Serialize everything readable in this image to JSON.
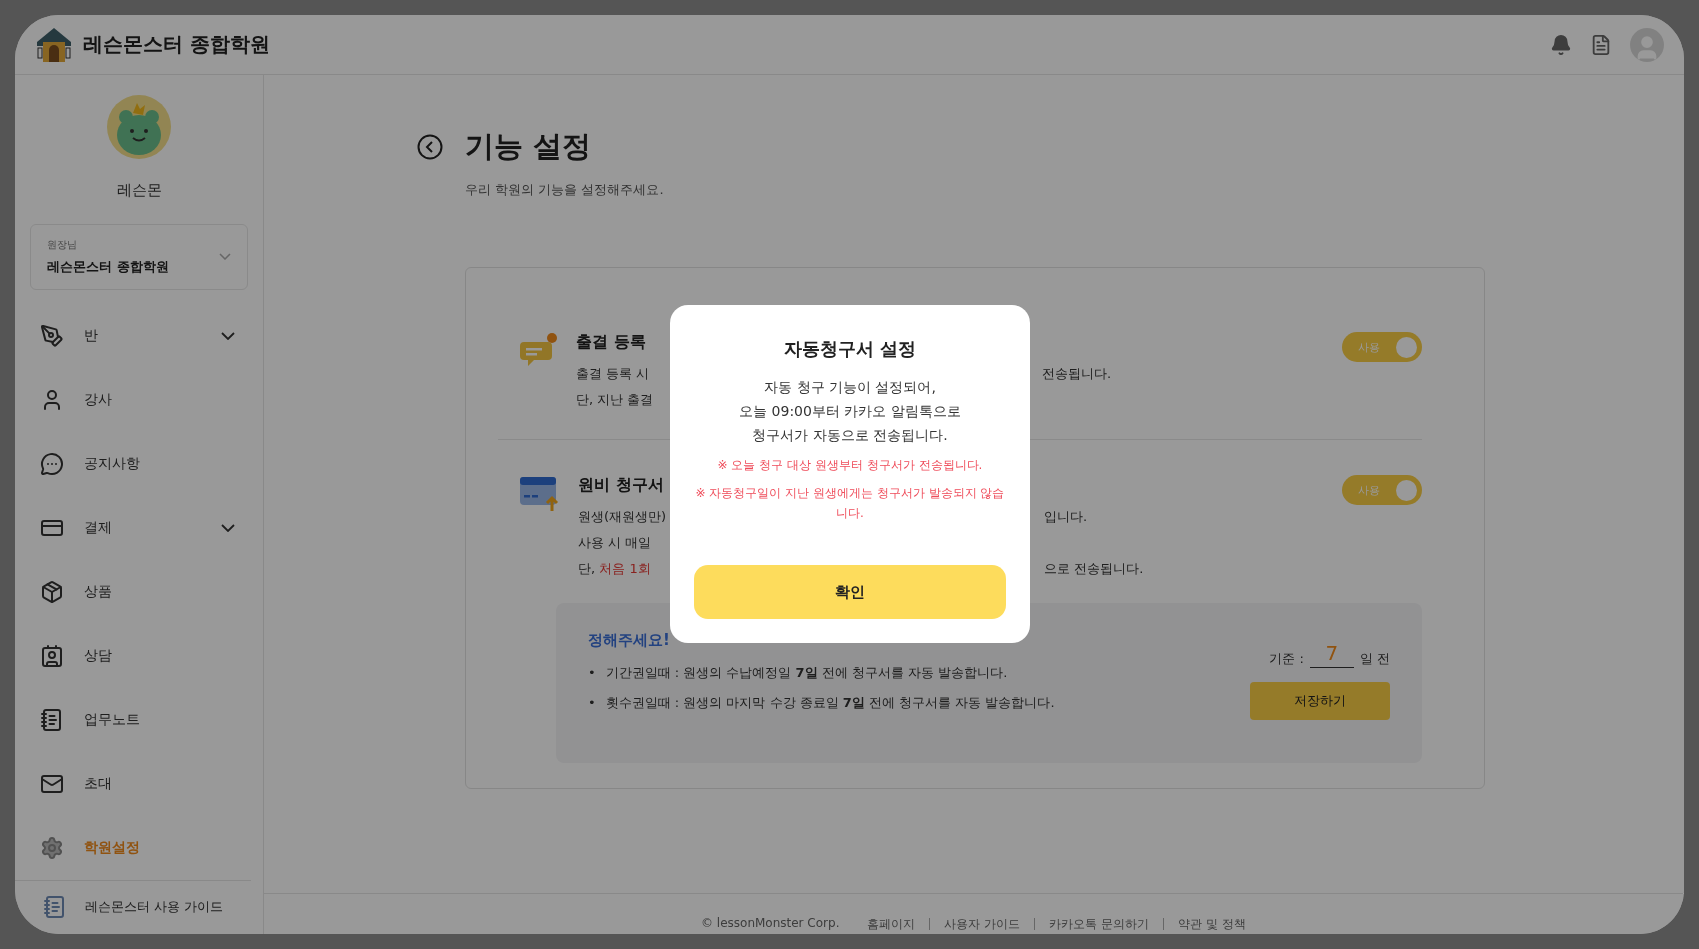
{
  "header": {
    "brand": "레슨몬스터 종합학원"
  },
  "profile": {
    "name": "레슨몬",
    "role": "원장님",
    "academy": "레슨몬스터 종합학원"
  },
  "sidebar": {
    "items": [
      {
        "label": "반",
        "expandable": true,
        "selected": false
      },
      {
        "label": "강사",
        "expandable": false,
        "selected": false
      },
      {
        "label": "공지사항",
        "expandable": false,
        "selected": false
      },
      {
        "label": "결제",
        "expandable": true,
        "selected": false
      },
      {
        "label": "상품",
        "expandable": false,
        "selected": false
      },
      {
        "label": "상담",
        "expandable": false,
        "selected": false
      },
      {
        "label": "업무노트",
        "expandable": false,
        "selected": false
      },
      {
        "label": "초대",
        "expandable": false,
        "selected": false
      },
      {
        "label": "학원설정",
        "expandable": false,
        "selected": true
      }
    ],
    "guide": "레슨몬스터 사용 가이드"
  },
  "page": {
    "title": "기능 설정",
    "subtitle": "우리 학원의 기능을 설정해주세요."
  },
  "features": [
    {
      "title": "출결 등록",
      "toggle_label": "사용",
      "on": true,
      "lines": [
        {
          "left": "출결 등록 시",
          "right": "전송됩니다."
        },
        {
          "left": "단, 지난 출결"
        }
      ]
    },
    {
      "title": "원비 청구서",
      "toggle_label": "사용",
      "on": true,
      "lines": [
        {
          "left": "원생(재원생만)",
          "right": "입니다."
        },
        {
          "left": "사용 시 매일"
        },
        {
          "left": "단, ",
          "left_red": "처음 1회",
          "right": "으로 전송됩니다."
        }
      ]
    }
  ],
  "notice_box": {
    "heading": "정해주세요!",
    "bullets": [
      {
        "marker": "•",
        "text": "기간권일때 : 원생의 수납예정일 **7일** 전에 청구서를 자동 발송합니다."
      },
      {
        "marker": "•",
        "text": "횟수권일때 : 원생의 마지막 수강 종료일 **7일** 전에 청구서를 자동 발송합니다."
      }
    ],
    "basis_label": "기준 :",
    "basis_value": "7",
    "basis_unit": "일 전",
    "save": "저장하기"
  },
  "footer": {
    "copyright": "© lessonMonster Corp.",
    "links": [
      "홈페이지",
      "사용자 가이드",
      "카카오톡 문의하기",
      "약관 및 정책"
    ]
  },
  "dialog": {
    "title": "자동청구서 설정",
    "message": "자동 청구 기능이 설정되어,\n오늘 09:00부터 카카오 알림톡으로\n청구서가 자동으로 전송됩니다.",
    "notes": [
      "※ 오늘 청구 대상 원생부터 청구서가 전송됩니다.",
      "※ 자동청구일이 지난 원생에게는 청구서가 발송되지 않습니다."
    ],
    "confirm": "확인"
  }
}
